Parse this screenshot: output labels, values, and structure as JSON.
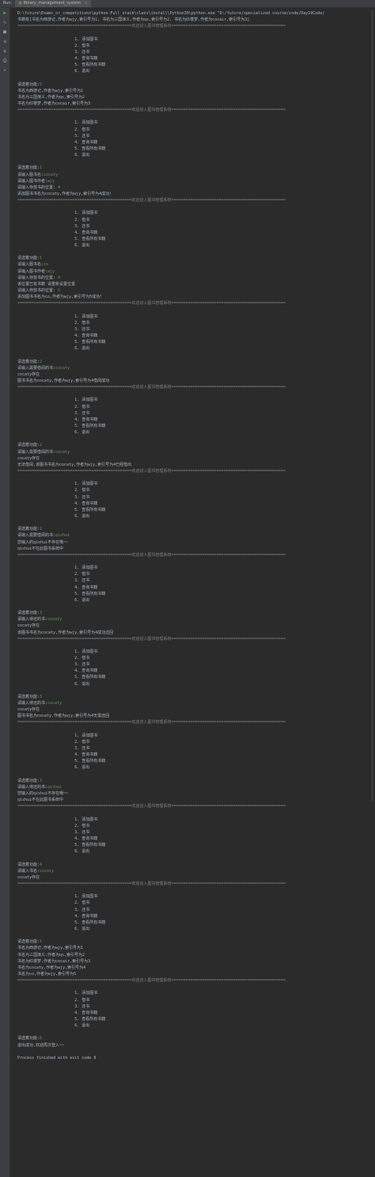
{
  "topbar": {
    "run_label": "Run:",
    "tab_label": "library_management_system",
    "close": "×"
  },
  "sidebar_icons": [
    "run-icon",
    "wrench-icon",
    "stop-icon",
    "soft-wrap-icon",
    "scroll-end-icon",
    "print-icon",
    "pin-icon"
  ],
  "console_lines": [
    "D:\\future\\Exams_or_competitions\\python-Full_stack\\class\\install\\Python39\\python.exe \"D:/future/specialized course/code/Day19Code/",
    "书籍有[书名为西游记,作者为wjy,索引号为1, 书名为三国演义,作者为qs,索引号为2, 书名为红楼梦,作者为cocair,索引号为3]",
    "================================================欢迎进入图书管理系统================================================",
    "",
    "                        1. 添加图书",
    "                        2. 借书",
    "                        3. 还书",
    "                        4. 查询书籍",
    "                        5. 查看所有书籍",
    "                        6. 退出",
    "",
    "请选着功能:5",
    "书名为西游记,作者为wjy,索引号为1",
    "书名为三国演义,作者为qs,索引号为2",
    "书名为红楼梦,作者为cocair,索引号为3",
    "================================================欢迎进入图书管理系统================================================",
    "",
    "                        1. 添加图书",
    "                        2. 借书",
    "                        3. 还书",
    "                        4. 查询书籍",
    "                        5. 查看所有书籍",
    "                        6. 退出",
    "",
    "请选着功能:1",
    "请输入图书名:cocaty",
    "请输入图书作者:wjy",
    "请输入存放书的位置: 4",
    "添加图书书名为cocaty,作者为wjy,索引号为4成功!",
    "================================================欢迎进入图书管理系统================================================",
    "",
    "                        1. 添加图书",
    "                        2. 借书",
    "                        3. 还书",
    "                        4. 查询书籍",
    "                        5. 查看所有书籍",
    "                        6. 退出",
    "",
    "请选着功能:1",
    "请输入图书名:co",
    "请输入图书作者:wjy",
    "请输入存放书的位置: 4",
    "该位置已有书籍 请重新设置位置",
    "请输入存放书的位置: 5",
    "添加图书书名为co,作者为wjy,索引号为5成功!",
    "================================================欢迎进入图书管理系统================================================",
    "",
    "                        1. 添加图书",
    "                        2. 借书",
    "                        3. 还书",
    "                        4. 查询书籍",
    "                        5. 查看所有书籍",
    "                        6. 退出",
    "",
    "请选着功能:2",
    "请输入需要借阅的书:cocaty",
    "cocaty存在",
    "图书书名为cocaty,作者为wjy,索引号为4借阅成功",
    "================================================欢迎进入图书管理系统================================================",
    "",
    "                        1. 添加图书",
    "                        2. 借书",
    "                        3. 还书",
    "                        4. 查询书籍",
    "                        5. 查看所有书籍",
    "                        6. 退出",
    "",
    "请选着功能:2",
    "请输入需要借阅的书:cocaty",
    "cocaty存在",
    "无法借阅,该图书书名为cocaty,作者为wjy,索引号为4已经借出",
    "================================================欢迎进入图书管理系统================================================",
    "",
    "                        1. 添加图书",
    "                        2. 借书",
    "                        3. 还书",
    "                        4. 查询书籍",
    "                        5. 查看所有书籍",
    "                        6. 退出",
    "",
    "请选着功能:2",
    "请输入需要借阅的书:qishui",
    "您输入的qishui不存在哦~~",
    "qishui不在此图书系统中",
    "================================================欢迎进入图书管理系统================================================",
    "",
    "                        1. 添加图书",
    "                        2. 借书",
    "                        3. 还书",
    "                        4. 查询书籍",
    "                        5. 查看所有书籍",
    "                        6. 退出",
    "",
    "请选着功能:3",
    "请输入待还的书:cocaty",
    "cocaty存在",
    "该图书书名为cocaty,作者为wjy,索引号为4成功还回",
    "================================================欢迎进入图书管理系统================================================",
    "",
    "                        1. 添加图书",
    "                        2. 借书",
    "                        3. 还书",
    "                        4. 查询书籍",
    "                        5. 查看所有书籍",
    "                        6. 退出",
    "",
    "请选着功能:3",
    "请输入待还的书:cocaty",
    "cocaty存在",
    "图书书名为cocaty,作者为wjy,索引号为4无需还回",
    "================================================欢迎进入图书管理系统================================================",
    "",
    "                        1. 添加图书",
    "                        2. 借书",
    "                        3. 还书",
    "                        4. 查询书籍",
    "                        5. 查看所有书籍",
    "                        6. 退出",
    "",
    "请选着功能:3",
    "请输入待还的书:qishui",
    "您输入的qishui不存在哦~~",
    "qishui不在此图书系统中",
    "================================================欢迎进入图书管理系统================================================",
    "",
    "                        1. 添加图书",
    "                        2. 借书",
    "                        3. 还书",
    "                        4. 查询书籍",
    "                        5. 查看所有书籍",
    "                        6. 退出",
    "",
    "请选着功能:4",
    "请输入书名:cocaty",
    "cocaty存在",
    "================================================欢迎进入图书管理系统================================================",
    "",
    "                        1. 添加图书",
    "                        2. 借书",
    "                        3. 还书",
    "                        4. 查询书籍",
    "                        5. 查看所有书籍",
    "                        6. 退出",
    "",
    "请选着功能:5",
    "书名为西游记,作者为wjy,索引号为1",
    "书名为三国演义,作者为qs,索引号为2",
    "书名为红楼梦,作者为cocair,索引号为3",
    "书名为cocaty,作者为wjy,索引号为4",
    "书名为co,作者为wjy,索引号为5",
    "================================================欢迎进入图书管理系统================================================",
    "",
    "                        1. 添加图书",
    "                        2. 借书",
    "                        3. 还书",
    "                        4. 查询书籍",
    "                        5. 查看所有书籍",
    "                        6. 退出",
    "",
    "请选着功能:6",
    "退出成功,欢迎再次登入~~",
    "",
    "Process finished with exit code 0"
  ],
  "colors": {
    "input": "#629755",
    "separator": "#808080",
    "text": "#a9b7c6",
    "background": "#2b2b2b"
  }
}
